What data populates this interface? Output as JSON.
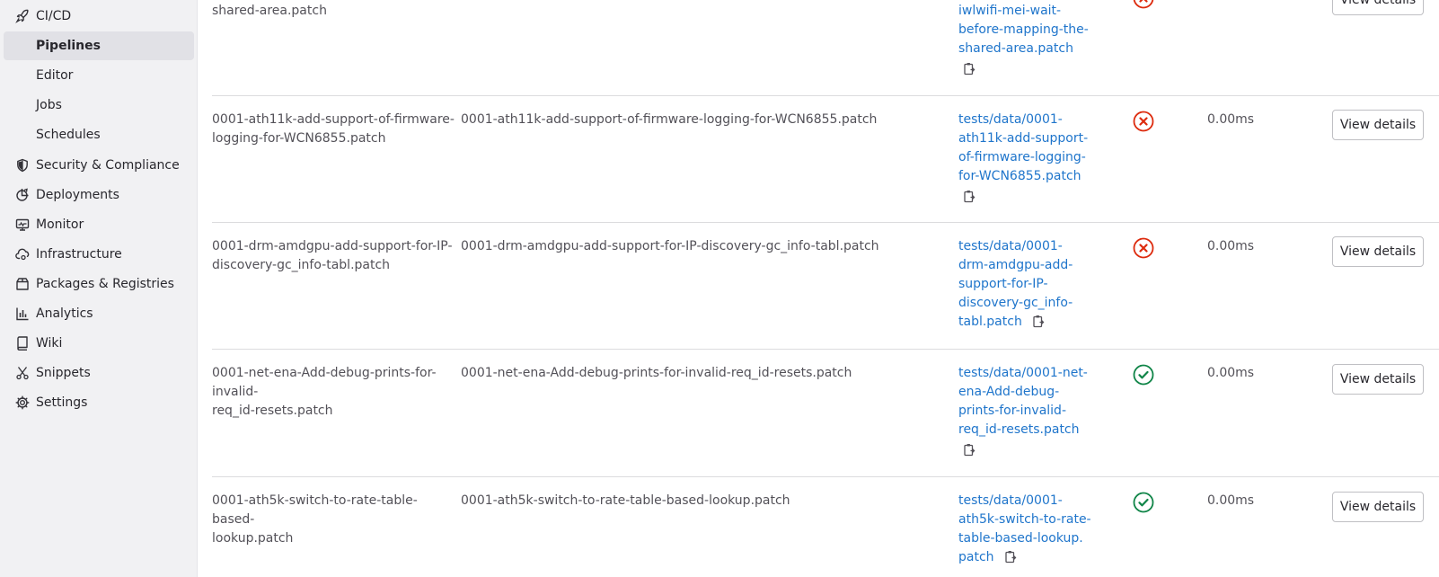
{
  "sidebar": {
    "section": {
      "label": "CI/CD",
      "icon": "rocket-icon"
    },
    "sub_items": [
      {
        "label": "Pipelines",
        "active": true
      },
      {
        "label": "Editor",
        "active": false
      },
      {
        "label": "Jobs",
        "active": false
      },
      {
        "label": "Schedules",
        "active": false
      }
    ],
    "items": [
      {
        "label": "Security & Compliance",
        "icon": "shield-icon"
      },
      {
        "label": "Deployments",
        "icon": "deployments-icon"
      },
      {
        "label": "Monitor",
        "icon": "monitor-icon"
      },
      {
        "label": "Infrastructure",
        "icon": "cloud-gear-icon"
      },
      {
        "label": "Packages & Registries",
        "icon": "package-icon"
      },
      {
        "label": "Analytics",
        "icon": "chart-icon"
      },
      {
        "label": "Wiki",
        "icon": "book-icon"
      },
      {
        "label": "Snippets",
        "icon": "snippet-icon"
      },
      {
        "label": "Settings",
        "icon": "gear-icon"
      }
    ]
  },
  "table": {
    "partial_row": {
      "name": "shared-area.patch",
      "location_lines": [
        "iwlwifi-mei-wait-",
        "before-mapping-the-",
        "shared-area.patch"
      ],
      "status": "failed",
      "button": "View details"
    },
    "rows": [
      {
        "name_lines": [
          "0001-ath11k-add-support-of-firmware-",
          "logging-for-WCN6855.patch"
        ],
        "file": "0001-ath11k-add-support-of-firmware-logging-for-WCN6855.patch",
        "location_lines": [
          "tests/data/0001-",
          "ath11k-add-support-",
          "of-firmware-logging-",
          "for-WCN6855.patch"
        ],
        "status": "failed",
        "time": "0.00ms",
        "button": "View details"
      },
      {
        "name_lines": [
          "0001-drm-amdgpu-add-support-for-IP-",
          "discovery-gc_info-tabl.patch"
        ],
        "file": "0001-drm-amdgpu-add-support-for-IP-discovery-gc_info-tabl.patch",
        "location_lines": [
          "tests/data/0001-",
          "drm-amdgpu-add-",
          "support-for-IP-",
          "discovery-gc_info-",
          "tabl.patch"
        ],
        "status": "failed",
        "time": "0.00ms",
        "button": "View details"
      },
      {
        "name_lines": [
          "0001-net-ena-Add-debug-prints-for-invalid-",
          "req_id-resets.patch"
        ],
        "file": "0001-net-ena-Add-debug-prints-for-invalid-req_id-resets.patch",
        "location_lines": [
          "tests/data/0001-net-",
          "ena-Add-debug-",
          "prints-for-invalid-",
          "req_id-resets.patch"
        ],
        "status": "success",
        "time": "0.00ms",
        "button": "View details"
      },
      {
        "name_lines": [
          "0001-ath5k-switch-to-rate-table-based-",
          "lookup.patch"
        ],
        "file": "0001-ath5k-switch-to-rate-table-based-lookup.patch",
        "location_lines": [
          "tests/data/0001-",
          "ath5k-switch-to-rate-",
          "table-based-lookup.",
          "patch"
        ],
        "status": "success",
        "time": "0.00ms",
        "button": "View details"
      }
    ]
  },
  "colors": {
    "link": "#1f75cb",
    "failed": "#dd2b0e",
    "success": "#108548",
    "sidebar_bg": "#f1f1f3",
    "active_bg": "#e1e1e6"
  }
}
